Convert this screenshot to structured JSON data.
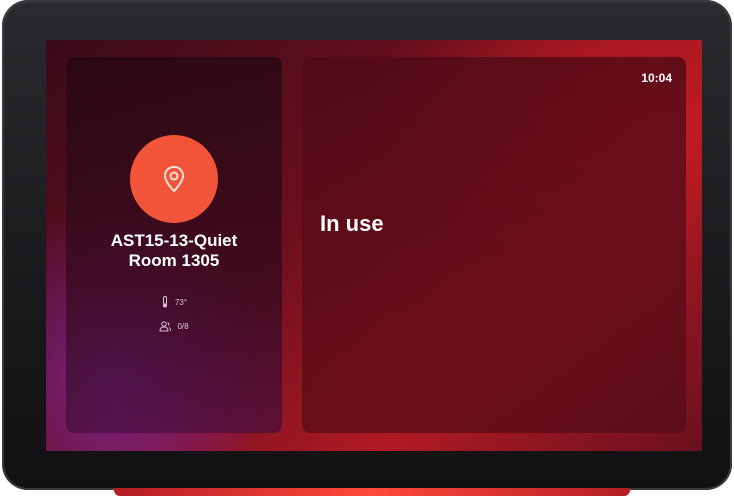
{
  "device": {
    "room_name_line1": "AST15-13-Quiet",
    "room_name_line2": "Room 1305",
    "temperature": "73°",
    "occupancy": "0/8",
    "clock": "10:04",
    "status": "In use"
  },
  "icons": {
    "location": "location-pin-icon",
    "temperature": "thermometer-icon",
    "occupancy": "people-icon"
  },
  "colors": {
    "accent": "#f2543a",
    "background_red": "#b01a23",
    "background_purple": "#7b2496"
  }
}
